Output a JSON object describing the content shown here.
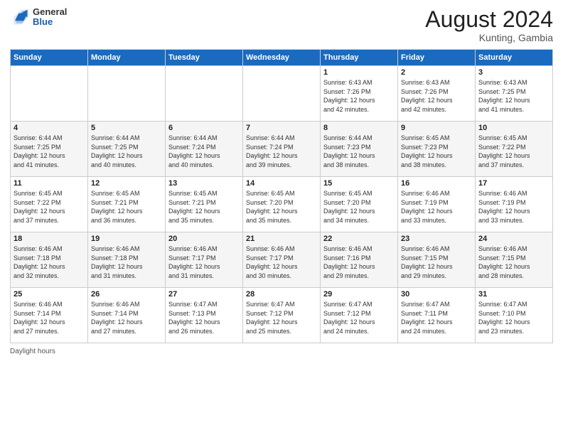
{
  "logo": {
    "general": "General",
    "blue": "Blue"
  },
  "title": {
    "month_year": "August 2024",
    "location": "Kunting, Gambia"
  },
  "days_of_week": [
    "Sunday",
    "Monday",
    "Tuesday",
    "Wednesday",
    "Thursday",
    "Friday",
    "Saturday"
  ],
  "footer": {
    "daylight_label": "Daylight hours"
  },
  "weeks": [
    [
      {
        "day": "",
        "content": ""
      },
      {
        "day": "",
        "content": ""
      },
      {
        "day": "",
        "content": ""
      },
      {
        "day": "",
        "content": ""
      },
      {
        "day": "1",
        "content": "Sunrise: 6:43 AM\nSunset: 7:26 PM\nDaylight: 12 hours\nand 42 minutes."
      },
      {
        "day": "2",
        "content": "Sunrise: 6:43 AM\nSunset: 7:26 PM\nDaylight: 12 hours\nand 42 minutes."
      },
      {
        "day": "3",
        "content": "Sunrise: 6:43 AM\nSunset: 7:25 PM\nDaylight: 12 hours\nand 41 minutes."
      }
    ],
    [
      {
        "day": "4",
        "content": "Sunrise: 6:44 AM\nSunset: 7:25 PM\nDaylight: 12 hours\nand 41 minutes."
      },
      {
        "day": "5",
        "content": "Sunrise: 6:44 AM\nSunset: 7:25 PM\nDaylight: 12 hours\nand 40 minutes."
      },
      {
        "day": "6",
        "content": "Sunrise: 6:44 AM\nSunset: 7:24 PM\nDaylight: 12 hours\nand 40 minutes."
      },
      {
        "day": "7",
        "content": "Sunrise: 6:44 AM\nSunset: 7:24 PM\nDaylight: 12 hours\nand 39 minutes."
      },
      {
        "day": "8",
        "content": "Sunrise: 6:44 AM\nSunset: 7:23 PM\nDaylight: 12 hours\nand 38 minutes."
      },
      {
        "day": "9",
        "content": "Sunrise: 6:45 AM\nSunset: 7:23 PM\nDaylight: 12 hours\nand 38 minutes."
      },
      {
        "day": "10",
        "content": "Sunrise: 6:45 AM\nSunset: 7:22 PM\nDaylight: 12 hours\nand 37 minutes."
      }
    ],
    [
      {
        "day": "11",
        "content": "Sunrise: 6:45 AM\nSunset: 7:22 PM\nDaylight: 12 hours\nand 37 minutes."
      },
      {
        "day": "12",
        "content": "Sunrise: 6:45 AM\nSunset: 7:21 PM\nDaylight: 12 hours\nand 36 minutes."
      },
      {
        "day": "13",
        "content": "Sunrise: 6:45 AM\nSunset: 7:21 PM\nDaylight: 12 hours\nand 35 minutes."
      },
      {
        "day": "14",
        "content": "Sunrise: 6:45 AM\nSunset: 7:20 PM\nDaylight: 12 hours\nand 35 minutes."
      },
      {
        "day": "15",
        "content": "Sunrise: 6:45 AM\nSunset: 7:20 PM\nDaylight: 12 hours\nand 34 minutes."
      },
      {
        "day": "16",
        "content": "Sunrise: 6:46 AM\nSunset: 7:19 PM\nDaylight: 12 hours\nand 33 minutes."
      },
      {
        "day": "17",
        "content": "Sunrise: 6:46 AM\nSunset: 7:19 PM\nDaylight: 12 hours\nand 33 minutes."
      }
    ],
    [
      {
        "day": "18",
        "content": "Sunrise: 6:46 AM\nSunset: 7:18 PM\nDaylight: 12 hours\nand 32 minutes."
      },
      {
        "day": "19",
        "content": "Sunrise: 6:46 AM\nSunset: 7:18 PM\nDaylight: 12 hours\nand 31 minutes."
      },
      {
        "day": "20",
        "content": "Sunrise: 6:46 AM\nSunset: 7:17 PM\nDaylight: 12 hours\nand 31 minutes."
      },
      {
        "day": "21",
        "content": "Sunrise: 6:46 AM\nSunset: 7:17 PM\nDaylight: 12 hours\nand 30 minutes."
      },
      {
        "day": "22",
        "content": "Sunrise: 6:46 AM\nSunset: 7:16 PM\nDaylight: 12 hours\nand 29 minutes."
      },
      {
        "day": "23",
        "content": "Sunrise: 6:46 AM\nSunset: 7:15 PM\nDaylight: 12 hours\nand 29 minutes."
      },
      {
        "day": "24",
        "content": "Sunrise: 6:46 AM\nSunset: 7:15 PM\nDaylight: 12 hours\nand 28 minutes."
      }
    ],
    [
      {
        "day": "25",
        "content": "Sunrise: 6:46 AM\nSunset: 7:14 PM\nDaylight: 12 hours\nand 27 minutes."
      },
      {
        "day": "26",
        "content": "Sunrise: 6:46 AM\nSunset: 7:14 PM\nDaylight: 12 hours\nand 27 minutes."
      },
      {
        "day": "27",
        "content": "Sunrise: 6:47 AM\nSunset: 7:13 PM\nDaylight: 12 hours\nand 26 minutes."
      },
      {
        "day": "28",
        "content": "Sunrise: 6:47 AM\nSunset: 7:12 PM\nDaylight: 12 hours\nand 25 minutes."
      },
      {
        "day": "29",
        "content": "Sunrise: 6:47 AM\nSunset: 7:12 PM\nDaylight: 12 hours\nand 24 minutes."
      },
      {
        "day": "30",
        "content": "Sunrise: 6:47 AM\nSunset: 7:11 PM\nDaylight: 12 hours\nand 24 minutes."
      },
      {
        "day": "31",
        "content": "Sunrise: 6:47 AM\nSunset: 7:10 PM\nDaylight: 12 hours\nand 23 minutes."
      }
    ]
  ]
}
